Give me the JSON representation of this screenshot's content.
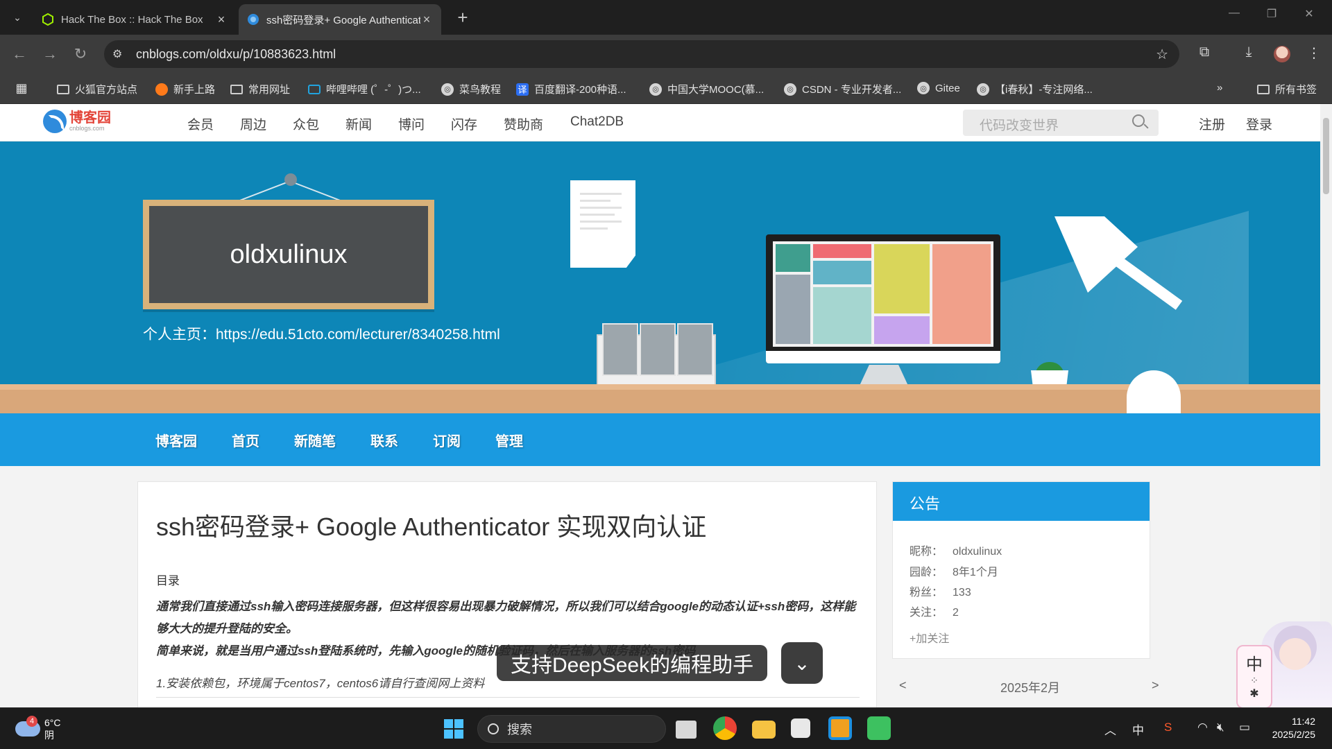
{
  "browser": {
    "tabs": [
      {
        "title": "Hack The Box :: Hack The Box",
        "active": false
      },
      {
        "title": "ssh密码登录+ Google Authenticator",
        "active": true
      }
    ],
    "url": "cnblogs.com/oldxu/p/10883623.html",
    "bookmarks": [
      "火狐官方站点",
      "新手上路",
      "常用网址",
      "哔哩哔哩 (゜-゜)つ...",
      "菜鸟教程",
      "百度翻译-200种语...",
      "中国大学MOOC(慕...",
      "CSDN - 专业开发者...",
      "Gitee",
      "【i春秋】-专注网络..."
    ],
    "all_bookmarks": "所有书签"
  },
  "site": {
    "logo_cn": "博客园",
    "logo_en": "cnblogs.com",
    "nav": [
      "会员",
      "周边",
      "众包",
      "新闻",
      "博问",
      "闪存",
      "赞助商",
      "Chat2DB"
    ],
    "search_placeholder": "代码改变世界",
    "register": "注册",
    "login": "登录"
  },
  "blog": {
    "name": "oldxulinux",
    "homepage": "个人主页：https://edu.51cto.com/lecturer/8340258.html",
    "menu": [
      "博客园",
      "首页",
      "新随笔",
      "联系",
      "订阅",
      "管理"
    ]
  },
  "article": {
    "title": "ssh密码登录+ Google Authenticator 实现双向认证",
    "toc": "目录",
    "intro_1": "通常我们直接通过ssh输入密码连接服务器，但这样很容易出现暴力破解情况，所以我们可以结合google的动态认证+ssh密码，这样能够大大的提升登陆的安全。",
    "intro_2": "简单来说，就是当用户通过ssh登陆系统时，先输入google的随机验证码，然后在输入服务器的ssh密码",
    "step_1": "1.安装依赖包，环境属于centos7，centos6请自行查阅网上资料"
  },
  "sidebar": {
    "notice_title": "公告",
    "rows": [
      {
        "label": "昵称：",
        "value": "oldxulinux"
      },
      {
        "label": "园龄：",
        "value": "8年1个月"
      },
      {
        "label": "粉丝：",
        "value": "133"
      },
      {
        "label": "关注：",
        "value": "2"
      }
    ],
    "follow": "+加关注",
    "calendar_prev": "<",
    "calendar_month": "2025年2月",
    "calendar_next": ">"
  },
  "overlay": {
    "text": "支持DeepSeek的编程助手"
  },
  "ime_widget": "中",
  "taskbar": {
    "weather_badge": "4",
    "temperature": "6°C",
    "condition": "阴",
    "search": "搜索",
    "ime": "中",
    "time": "11:42",
    "date": "2025/2/25"
  },
  "colors": {
    "banner": "#0d86b7",
    "menu_bar": "#1a9ae0",
    "logo_red": "#e3453a"
  }
}
